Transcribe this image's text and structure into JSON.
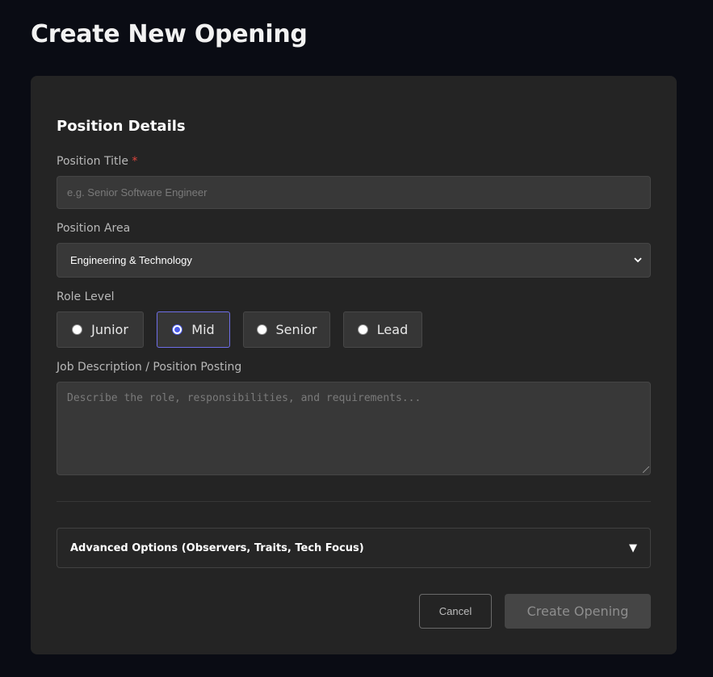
{
  "page": {
    "title": "Create New Opening"
  },
  "form": {
    "section_title": "Position Details",
    "position_title": {
      "label": "Position Title",
      "required_mark": "*",
      "placeholder": "e.g. Senior Software Engineer",
      "value": ""
    },
    "position_area": {
      "label": "Position Area",
      "selected": "Engineering & Technology",
      "icon": "chevron-down-icon"
    },
    "role_level": {
      "label": "Role Level",
      "options": [
        "Junior",
        "Mid",
        "Senior",
        "Lead"
      ],
      "selected": "Mid"
    },
    "job_description": {
      "label": "Job Description / Position Posting",
      "placeholder": "Describe the role, responsibilities, and requirements...",
      "value": ""
    },
    "advanced": {
      "label": "Advanced Options (Observers, Traits, Tech Focus)",
      "icon": "triangle-down-icon",
      "glyph": "▼"
    },
    "actions": {
      "cancel_label": "Cancel",
      "create_label": "Create Opening"
    }
  },
  "colors": {
    "background": "#0a0c14",
    "card": "#242424",
    "input": "#383838",
    "selected_border": "#6e6ee8",
    "required": "#e0453d"
  }
}
